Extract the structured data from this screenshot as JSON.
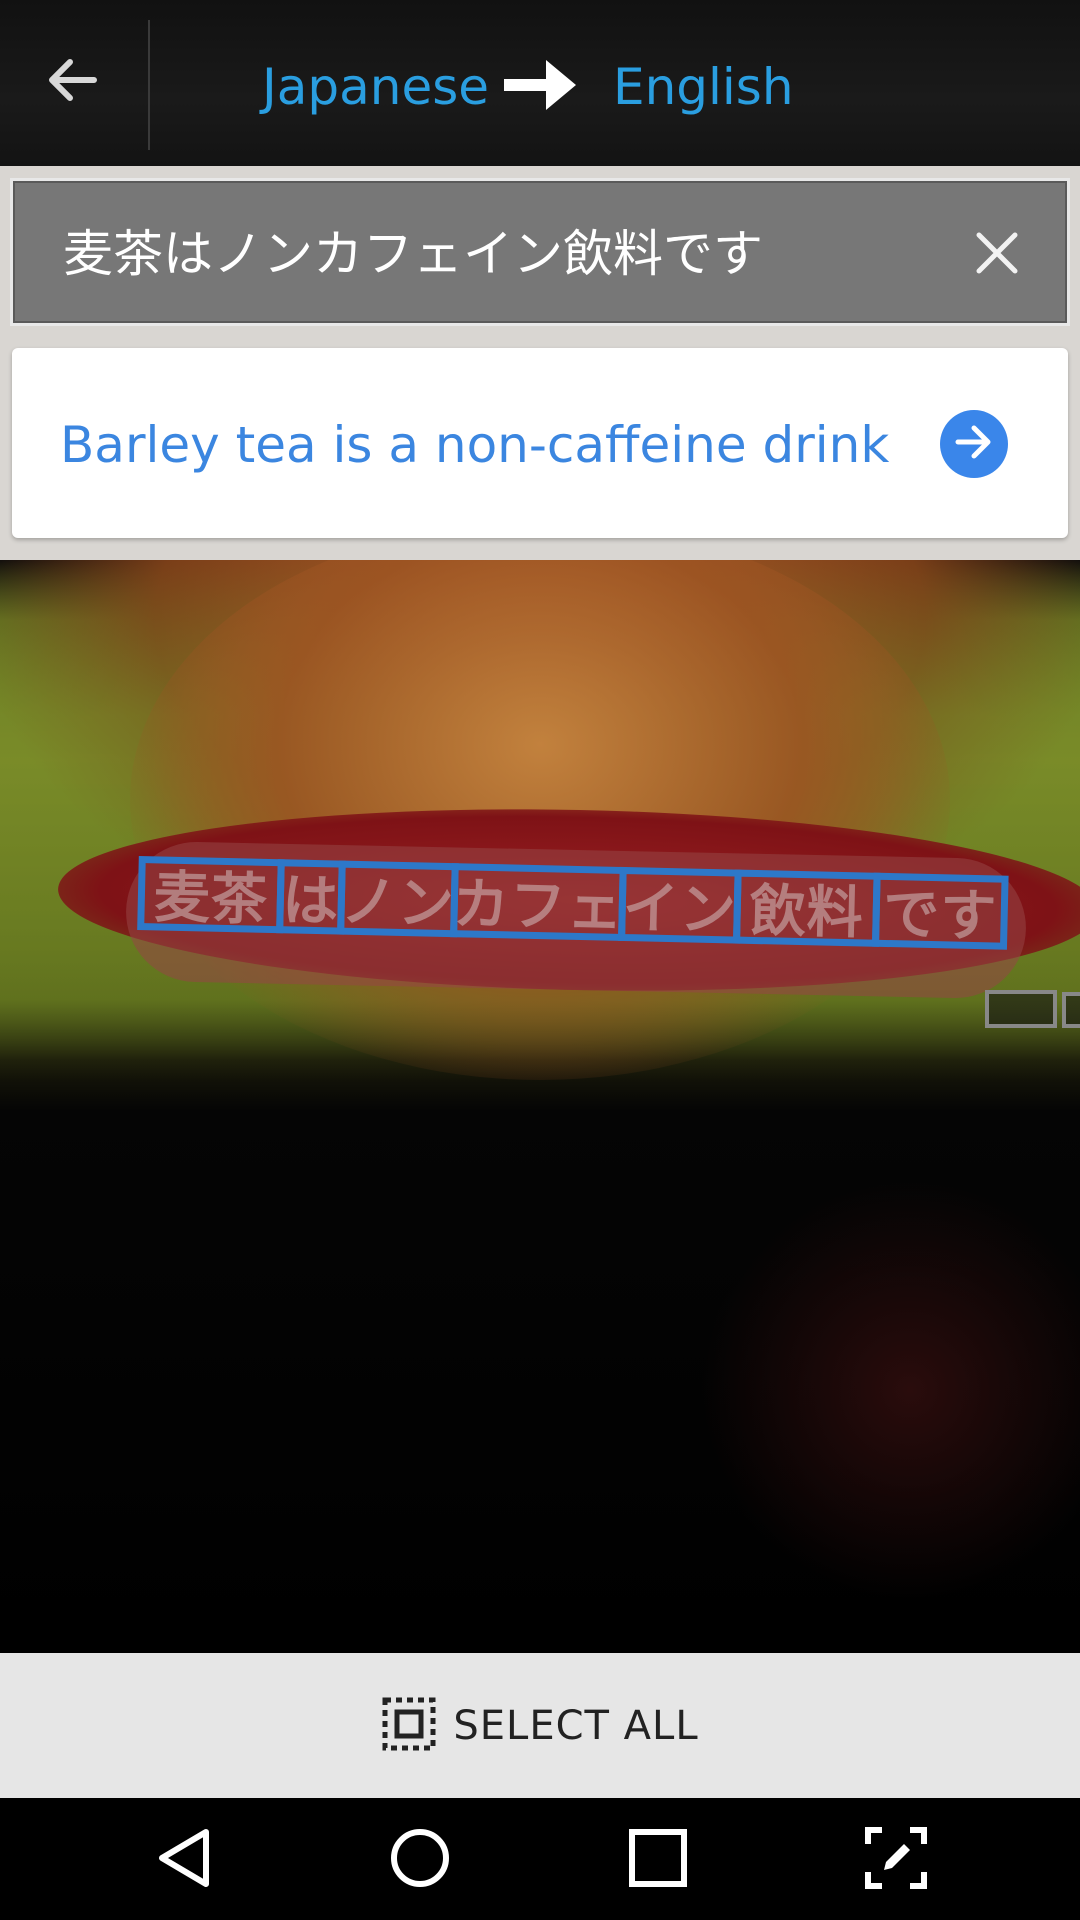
{
  "header": {
    "back_icon": "arrow-back-icon",
    "source_language": "Japanese",
    "target_language": "English",
    "direction_icon": "arrow-right-icon",
    "colors": {
      "language_text": "#2a9ee0",
      "bar_bg": "#151515"
    }
  },
  "source": {
    "text": "麦茶はノンカフェイン飲料です",
    "clear_icon": "close-icon"
  },
  "translation": {
    "text": "Barley tea is a non-caffeine drink",
    "go_icon": "arrow-right-circle-icon",
    "colors": {
      "text": "#3b86e0",
      "button": "#3a86ea"
    }
  },
  "camera": {
    "detected_segments": [
      "麦茶",
      "は",
      "ノン",
      "カフェ",
      "イン",
      "飲料",
      "です"
    ],
    "highlight_color": "#2d78c9"
  },
  "select_bar": {
    "label": "SELECT ALL",
    "icon": "select-all-icon"
  },
  "navbar": {
    "buttons": [
      "back-triangle-icon",
      "home-circle-icon",
      "recents-square-icon",
      "screenshot-edit-icon"
    ]
  }
}
